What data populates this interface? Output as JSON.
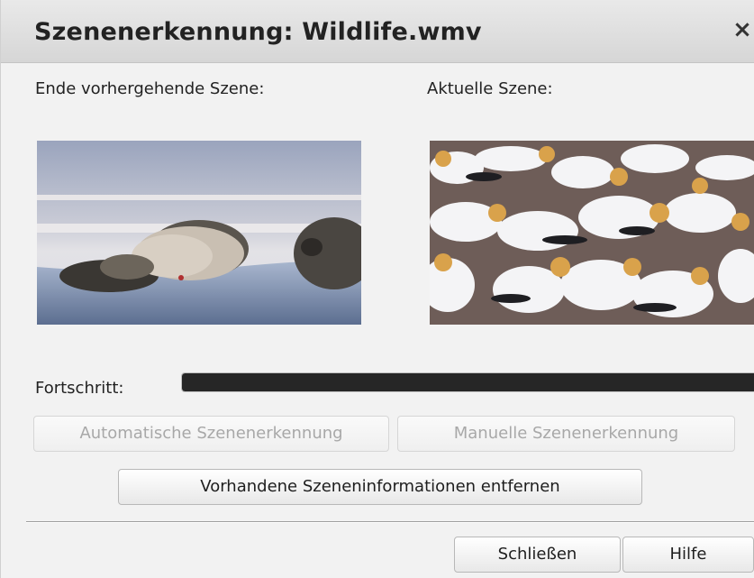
{
  "window": {
    "title": "Szenenerkennung: Wildlife.wmv",
    "close_glyph": "×"
  },
  "labels": {
    "previous_scene": "Ende vorhergehende Szene:",
    "current_scene": "Aktuelle Szene:",
    "progress": "Fortschritt:"
  },
  "progress": {
    "fraction": 1.0
  },
  "buttons": {
    "auto_detect": "Automatische Szenenerkennung",
    "manual_detect": "Manuelle Szenenerkennung",
    "remove_info": "Vorhandene Szeneninformationen entfernen",
    "close": "Schließen",
    "help": "Hilfe"
  },
  "thumbnails": {
    "previous": "seals-on-ice-thumbnail",
    "current": "gannets-colony-thumbnail"
  },
  "colors": {
    "progress_fill": "#262626",
    "dialog_bg": "#f2f2f2"
  }
}
